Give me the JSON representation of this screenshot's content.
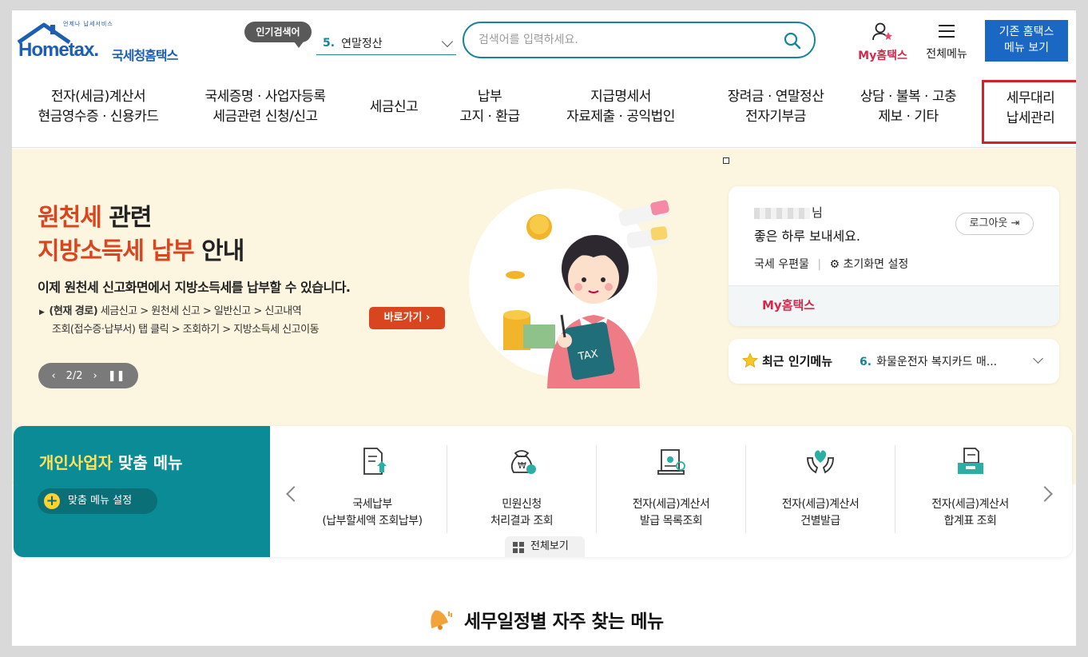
{
  "header": {
    "logo_tagline": "언제나 납세서비스",
    "logo_text": "Hometax.",
    "logo_kr": "국세청홈택스",
    "popular_badge": "인기검색어",
    "popular_num": "5.",
    "popular_term": "연말정산",
    "search_placeholder": "검색어를 입력하세요.",
    "my_hometax": "My홈택스",
    "all_menu": "전체메뉴",
    "legacy_line1": "기존 홈택스",
    "legacy_line2": "메뉴 보기"
  },
  "gnb": [
    {
      "l1": "전자(세금)계산서",
      "l2": "현금영수증 · 신용카드"
    },
    {
      "l1": "국세증명 · 사업자등록",
      "l2": "세금관련 신청/신고"
    },
    {
      "l1": "세금신고",
      "l2": ""
    },
    {
      "l1": "납부",
      "l2": "고지 · 환급"
    },
    {
      "l1": "지급명세서",
      "l2": "자료제출 · 공익법인"
    },
    {
      "l1": "장려금 · 연말정산",
      "l2": "전자기부금"
    },
    {
      "l1": "상담 · 불복 · 고충",
      "l2": "제보 · 기타"
    },
    {
      "l1": "세무대리",
      "l2": "납세관리"
    }
  ],
  "banner": {
    "title_red1": "원천세",
    "title_black1": " 관련",
    "title_red2": "지방소득세 납부",
    "title_black2": " 안내",
    "desc": "이제 원천세 신고화면에서 지방소득세를 납부할 수 있습니다.",
    "path_label": "(현재 경로)",
    "path_text1": " 세금신고 > 원천세 신고 > 일반신고 > 신고내역",
    "path_text2": "조회(접수증·납부서) 탭 클릭 > 조회하기 > 지방소득세 신고이동",
    "go_button": "바로가기",
    "pager": "2/2",
    "illus_tax": "TAX"
  },
  "user_card": {
    "name_suffix": "님",
    "greeting": "좋은 하루 보내세요.",
    "logout": "로그아웃",
    "mailbox": "국세 우편물",
    "home_setting": "초기화면 설정",
    "my_hometax": "My홈택스"
  },
  "popular_menu": {
    "title": "최근 인기메뉴",
    "num": "6.",
    "value": "화물운전자 복지카드 매..."
  },
  "custom_menu": {
    "title_hl": "개인사업자",
    "title_rest": " 맞춤 메뉴",
    "setting": "맞춤 메뉴 설정",
    "items": [
      {
        "l1": "국세납부",
        "l2": "(납부할세액 조회납부)",
        "icon": "tax-payment-icon"
      },
      {
        "l1": "민원신청",
        "l2": "처리결과 조회",
        "icon": "money-bag-icon"
      },
      {
        "l1": "전자(세금)계산서",
        "l2": "발급 목록조회",
        "icon": "certificate-icon"
      },
      {
        "l1": "전자(세금)계산서",
        "l2": "건별발급",
        "icon": "heart-hands-icon"
      },
      {
        "l1": "전자(세금)계산서",
        "l2": "합계표 조회",
        "icon": "document-tray-icon"
      }
    ],
    "all_view": "전체보기"
  },
  "section": {
    "title": "세무일정별 자주 찾는 메뉴"
  },
  "colors": {
    "brand_teal": "#0a8b95",
    "accent_red": "#d9451f",
    "legacy_blue": "#1a67c4",
    "highlight_box": "#d4202a"
  }
}
